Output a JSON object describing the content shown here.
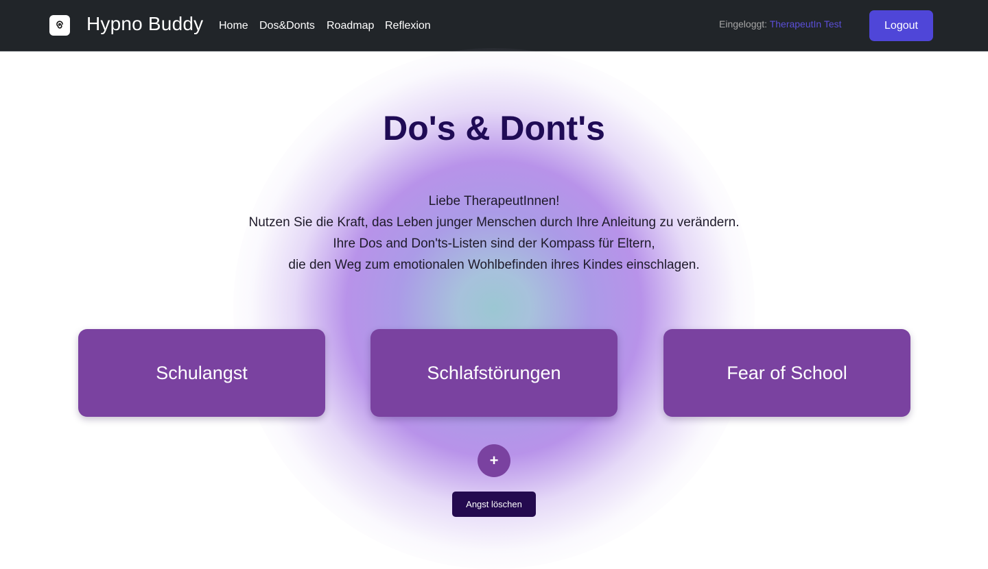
{
  "navbar": {
    "brand": "Hypno Buddy",
    "logo_icon": "spiral-icon",
    "links": [
      "Home",
      "Dos&Donts",
      "Roadmap",
      "Reflexion"
    ],
    "login_label": "Eingeloggt:",
    "login_user": "TherapeutIn Test",
    "logout_label": "Logout"
  },
  "main": {
    "title": "Do's & Dont's",
    "intro_lines": [
      "Liebe TherapeutInnen!",
      "Nutzen Sie die Kraft, das Leben junger Menschen durch Ihre Anleitung zu verändern.",
      "Ihre Dos and Don'ts-Listen sind der Kompass für Eltern,",
      "die den Weg zum emotionalen Wohlbefinden ihres Kindes einschlagen."
    ],
    "cards": [
      "Schulangst",
      "Schlafstörungen",
      "Fear of School"
    ],
    "add_label": "+",
    "delete_label": "Angst löschen"
  },
  "colors": {
    "navbar_bg": "#212529",
    "accent": "#4f46d8",
    "card_bg": "#7a42a0",
    "title": "#1f0b55",
    "delete_bg": "#240a4f"
  }
}
